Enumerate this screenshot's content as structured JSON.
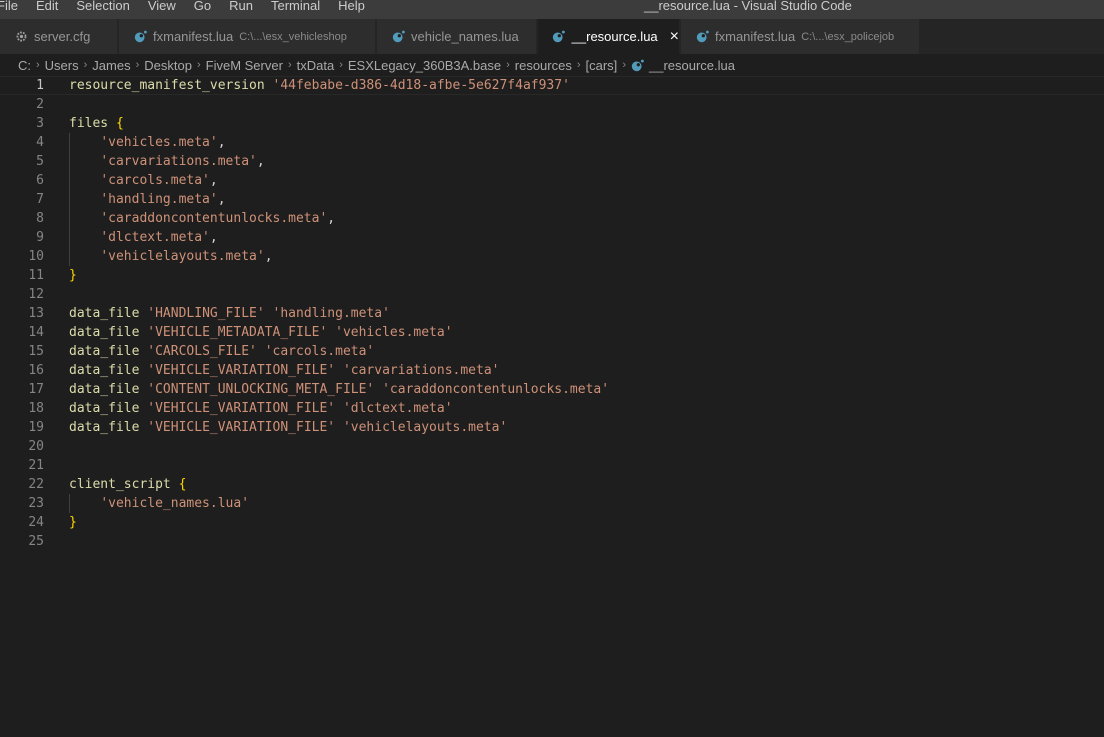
{
  "menu": [
    "File",
    "Edit",
    "Selection",
    "View",
    "Go",
    "Run",
    "Terminal",
    "Help"
  ],
  "window_title": "__resource.lua - Visual Studio Code",
  "tabs": [
    {
      "label": "server.cfg",
      "desc": "",
      "icon": "gear-icon",
      "active": false
    },
    {
      "label": "fxmanifest.lua",
      "desc": "C:\\...\\esx_vehicleshop",
      "icon": "lua-moon-icon",
      "active": false
    },
    {
      "label": "vehicle_names.lua",
      "desc": "",
      "icon": "lua-moon-icon",
      "active": false
    },
    {
      "label": "__resource.lua",
      "desc": "",
      "icon": "lua-moon-icon",
      "active": true,
      "close": "×"
    },
    {
      "label": "fxmanifest.lua",
      "desc": "C:\\...\\esx_policejob",
      "icon": "lua-moon-icon",
      "active": false
    }
  ],
  "breadcrumb": [
    "C:",
    "Users",
    "James",
    "Desktop",
    "FiveM Server",
    "txData",
    "ESXLegacy_360B3A.base",
    "resources",
    "[cars]",
    "__resource.lua"
  ],
  "colors": {
    "identifier": "#dcdcaa",
    "string": "#ce9178",
    "brace": "#ffd700",
    "punctuation": "#d4d4d4",
    "lua_icon": "#519aba"
  },
  "editor": {
    "current_line": 1,
    "lines": [
      [
        {
          "t": "resource_manifest_version",
          "c": "id"
        },
        {
          "t": " ",
          "c": "punc"
        },
        {
          "t": "'44febabe-d386-4d18-afbe-5e627f4af937'",
          "c": "str"
        }
      ],
      [],
      [
        {
          "t": "files",
          "c": "id"
        },
        {
          "t": " ",
          "c": "punc"
        },
        {
          "t": "{",
          "c": "brace"
        }
      ],
      [
        {
          "t": "    ",
          "c": "punc"
        },
        {
          "t": "'vehicles.meta'",
          "c": "str"
        },
        {
          "t": ",",
          "c": "punc"
        }
      ],
      [
        {
          "t": "    ",
          "c": "punc"
        },
        {
          "t": "'carvariations.meta'",
          "c": "str"
        },
        {
          "t": ",",
          "c": "punc"
        }
      ],
      [
        {
          "t": "    ",
          "c": "punc"
        },
        {
          "t": "'carcols.meta'",
          "c": "str"
        },
        {
          "t": ",",
          "c": "punc"
        }
      ],
      [
        {
          "t": "    ",
          "c": "punc"
        },
        {
          "t": "'handling.meta'",
          "c": "str"
        },
        {
          "t": ",",
          "c": "punc"
        }
      ],
      [
        {
          "t": "    ",
          "c": "punc"
        },
        {
          "t": "'caraddoncontentunlocks.meta'",
          "c": "str"
        },
        {
          "t": ",",
          "c": "punc"
        }
      ],
      [
        {
          "t": "    ",
          "c": "punc"
        },
        {
          "t": "'dlctext.meta'",
          "c": "str"
        },
        {
          "t": ",",
          "c": "punc"
        }
      ],
      [
        {
          "t": "    ",
          "c": "punc"
        },
        {
          "t": "'vehiclelayouts.meta'",
          "c": "str"
        },
        {
          "t": ",",
          "c": "punc"
        }
      ],
      [
        {
          "t": "}",
          "c": "brace"
        }
      ],
      [],
      [
        {
          "t": "data_file",
          "c": "id"
        },
        {
          "t": " ",
          "c": "punc"
        },
        {
          "t": "'HANDLING_FILE'",
          "c": "str"
        },
        {
          "t": " ",
          "c": "punc"
        },
        {
          "t": "'handling.meta'",
          "c": "str"
        }
      ],
      [
        {
          "t": "data_file",
          "c": "id"
        },
        {
          "t": " ",
          "c": "punc"
        },
        {
          "t": "'VEHICLE_METADATA_FILE'",
          "c": "str"
        },
        {
          "t": " ",
          "c": "punc"
        },
        {
          "t": "'vehicles.meta'",
          "c": "str"
        }
      ],
      [
        {
          "t": "data_file",
          "c": "id"
        },
        {
          "t": " ",
          "c": "punc"
        },
        {
          "t": "'CARCOLS_FILE'",
          "c": "str"
        },
        {
          "t": " ",
          "c": "punc"
        },
        {
          "t": "'carcols.meta'",
          "c": "str"
        }
      ],
      [
        {
          "t": "data_file",
          "c": "id"
        },
        {
          "t": " ",
          "c": "punc"
        },
        {
          "t": "'VEHICLE_VARIATION_FILE'",
          "c": "str"
        },
        {
          "t": " ",
          "c": "punc"
        },
        {
          "t": "'carvariations.meta'",
          "c": "str"
        }
      ],
      [
        {
          "t": "data_file",
          "c": "id"
        },
        {
          "t": " ",
          "c": "punc"
        },
        {
          "t": "'CONTENT_UNLOCKING_META_FILE'",
          "c": "str"
        },
        {
          "t": " ",
          "c": "punc"
        },
        {
          "t": "'caraddoncontentunlocks.meta'",
          "c": "str"
        }
      ],
      [
        {
          "t": "data_file",
          "c": "id"
        },
        {
          "t": " ",
          "c": "punc"
        },
        {
          "t": "'VEHICLE_VARIATION_FILE'",
          "c": "str"
        },
        {
          "t": " ",
          "c": "punc"
        },
        {
          "t": "'dlctext.meta'",
          "c": "str"
        }
      ],
      [
        {
          "t": "data_file",
          "c": "id"
        },
        {
          "t": " ",
          "c": "punc"
        },
        {
          "t": "'VEHICLE_VARIATION_FILE'",
          "c": "str"
        },
        {
          "t": " ",
          "c": "punc"
        },
        {
          "t": "'vehiclelayouts.meta'",
          "c": "str"
        }
      ],
      [],
      [],
      [
        {
          "t": "client_script",
          "c": "id"
        },
        {
          "t": " ",
          "c": "punc"
        },
        {
          "t": "{",
          "c": "brace"
        }
      ],
      [
        {
          "t": "    ",
          "c": "punc"
        },
        {
          "t": "'vehicle_names.lua'",
          "c": "str"
        }
      ],
      [
        {
          "t": "}",
          "c": "brace"
        }
      ],
      []
    ]
  }
}
